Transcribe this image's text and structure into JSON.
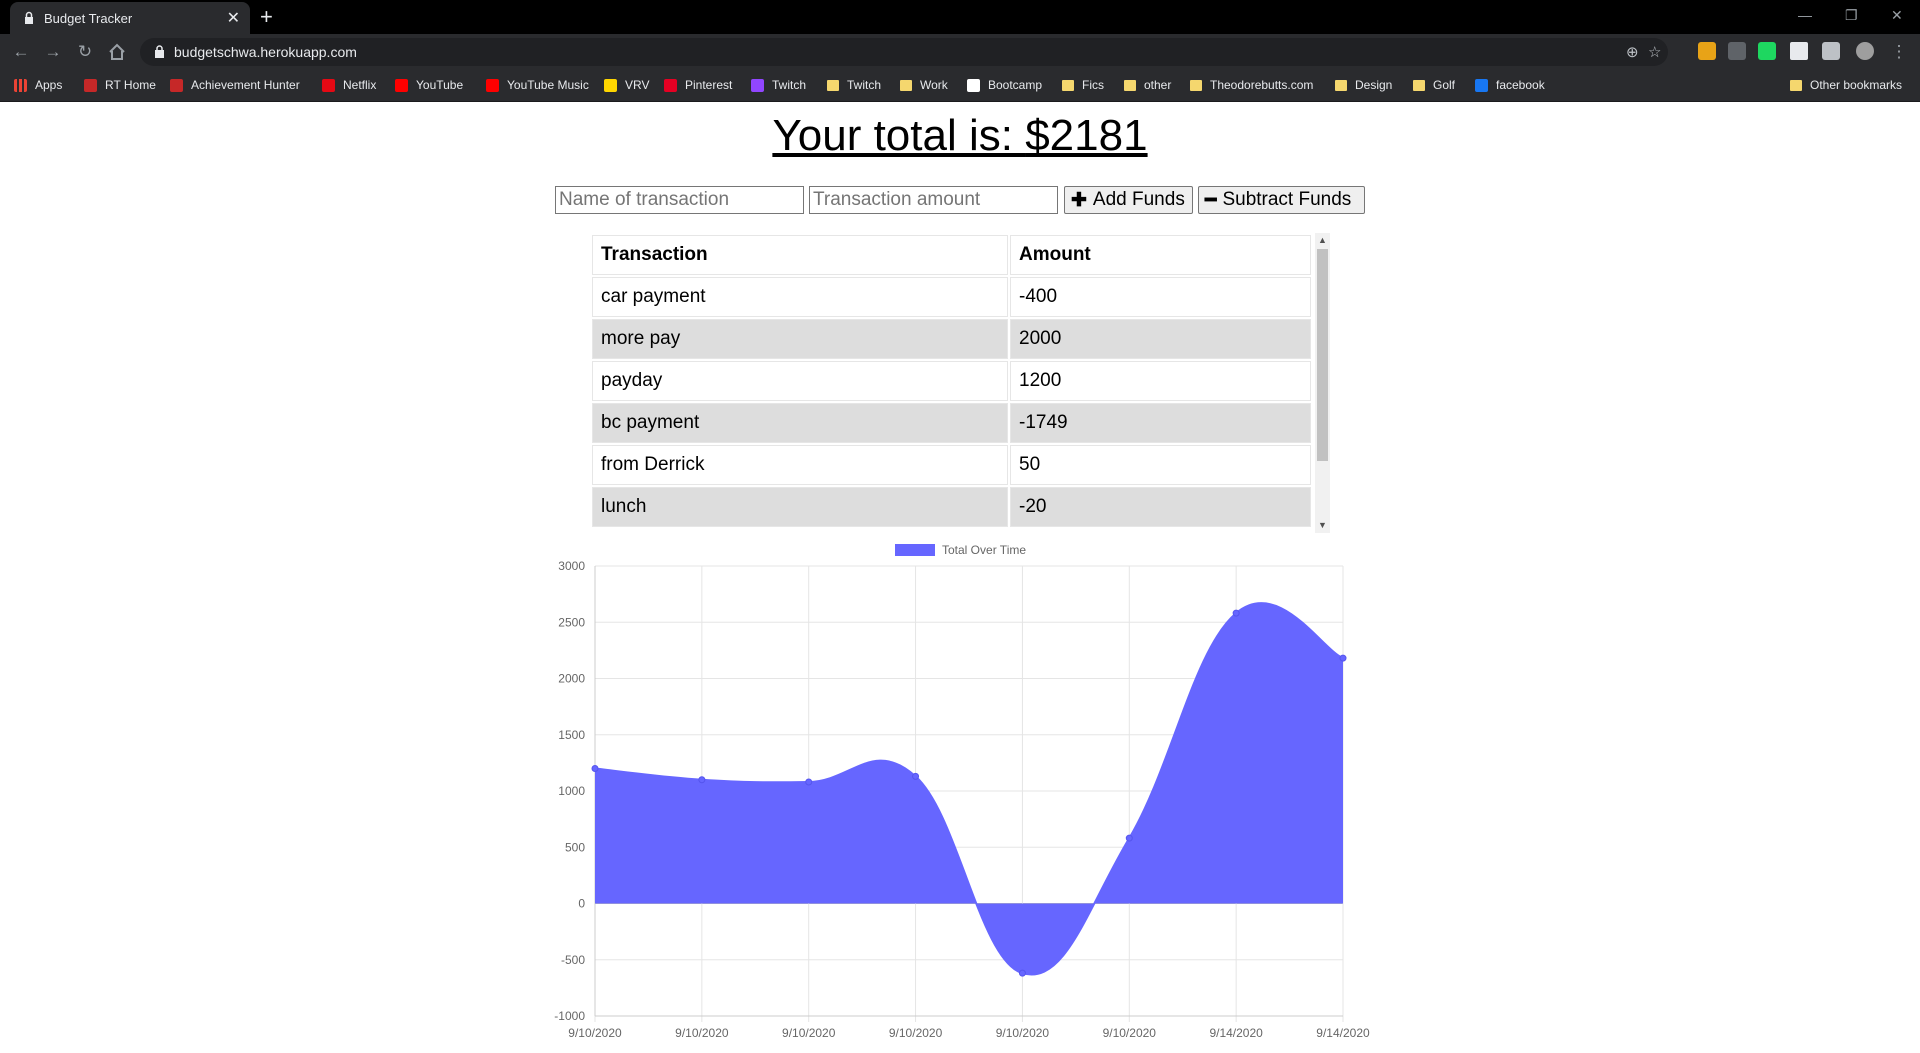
{
  "browser": {
    "tab_title": "Budget Tracker",
    "url": "budgetschwa.herokuapp.com",
    "bookmarks": [
      {
        "label": "Apps",
        "icon": "apps-grid-icon",
        "color": "#ea4335"
      },
      {
        "label": "RT Home",
        "icon": "rt-icon",
        "color": "#c62828"
      },
      {
        "label": "Achievement Hunter",
        "icon": "ah-icon",
        "color": "#c62828"
      },
      {
        "label": "Netflix",
        "icon": "netflix-icon",
        "color": "#e50914"
      },
      {
        "label": "YouTube",
        "icon": "youtube-icon",
        "color": "#ff0000"
      },
      {
        "label": "YouTube Music",
        "icon": "youtube-music-icon",
        "color": "#ff0000"
      },
      {
        "label": "VRV",
        "icon": "vrv-icon",
        "color": "#ffd600"
      },
      {
        "label": "Pinterest",
        "icon": "pinterest-icon",
        "color": "#e60023"
      },
      {
        "label": "Twitch",
        "icon": "twitch-icon",
        "color": "#9146ff"
      },
      {
        "label": "Twitch",
        "icon": "folder-icon",
        "color": "#f5d76e"
      },
      {
        "label": "Work",
        "icon": "folder-icon",
        "color": "#f5d76e"
      },
      {
        "label": "Bootcamp",
        "icon": "bootcamp-icon",
        "color": "#ffffff"
      },
      {
        "label": "Fics",
        "icon": "folder-icon",
        "color": "#f5d76e"
      },
      {
        "label": "other",
        "icon": "folder-icon",
        "color": "#f5d76e"
      },
      {
        "label": "Theodorebutts.com",
        "icon": "folder-icon",
        "color": "#f5d76e"
      },
      {
        "label": "Design",
        "icon": "folder-icon",
        "color": "#f5d76e"
      },
      {
        "label": "Golf",
        "icon": "folder-icon",
        "color": "#f5d76e"
      },
      {
        "label": "facebook",
        "icon": "facebook-icon",
        "color": "#1877f2"
      }
    ],
    "other_bookmarks": "Other bookmarks"
  },
  "page": {
    "total_label": "Your total is: ",
    "total_value": "$2181",
    "name_placeholder": "Name of transaction",
    "amount_placeholder": "Transaction amount",
    "add_label": "Add Funds",
    "subtract_label": "Subtract Funds",
    "table": {
      "headers": [
        "Transaction",
        "Amount"
      ],
      "rows": [
        [
          "car payment",
          "-400"
        ],
        [
          "more pay",
          "2000"
        ],
        [
          "payday",
          "1200"
        ],
        [
          "bc payment",
          "-1749"
        ],
        [
          "from Derrick",
          "50"
        ],
        [
          "lunch",
          "-20"
        ]
      ]
    }
  },
  "chart_data": {
    "type": "area",
    "legend": "Total Over Time",
    "color": "#6666ff",
    "x": [
      "9/10/2020",
      "9/10/2020",
      "9/10/2020",
      "9/10/2020",
      "9/10/2020",
      "9/10/2020",
      "9/14/2020",
      "9/14/2020"
    ],
    "values": [
      1200,
      1100,
      1080,
      1130,
      -619,
      581,
      2581,
      2181
    ],
    "ylim": [
      -1000,
      3000
    ],
    "yticks": [
      3000,
      2500,
      2000,
      1500,
      1000,
      500,
      0,
      -500,
      -1000
    ],
    "grid": true,
    "legend_position": "top"
  }
}
